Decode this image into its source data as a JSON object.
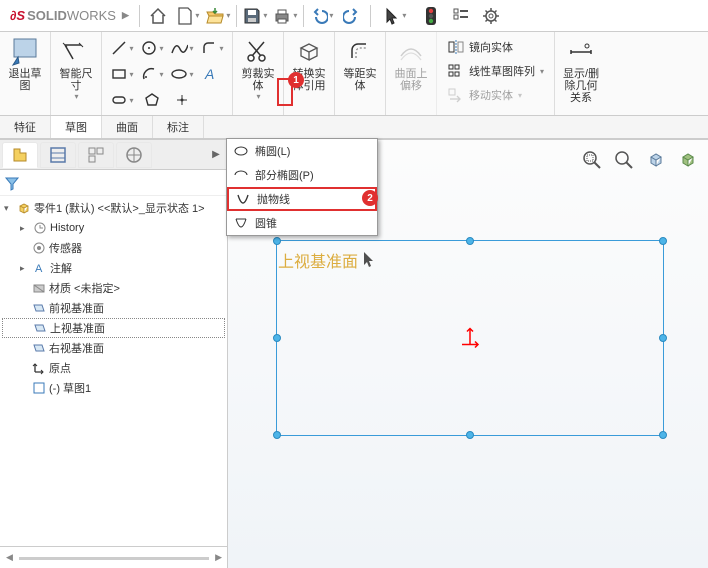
{
  "app": {
    "brand_prefix": "S",
    "brand": "SOLID",
    "brand2": "WORKS"
  },
  "ribbon": {
    "exit_sketch": "退出草\n图",
    "smart_dim": "智能尺\n寸",
    "trim": "剪裁实\n体",
    "convert": "转换实\n体引用",
    "offset": "等距实\n体",
    "on_surface": "曲面上\n偏移",
    "mirror": "镜向实体",
    "linear_pattern": "线性草图阵列",
    "move": "移动实体",
    "display": "显示/删\n除几何\n关系"
  },
  "tabs": {
    "t1": "特征",
    "t2": "草图",
    "t3": "曲面",
    "t4": "标注"
  },
  "menu": {
    "ellipse": "椭圆(L)",
    "partial_ellipse": "部分椭圆(P)",
    "parabola": "抛物线",
    "cone": "圆锥"
  },
  "tree": {
    "root": "零件1 (默认) <<默认>_显示状态 1>",
    "history": "History",
    "sensors": "传感器",
    "annotations": "注解",
    "material": "材质 <未指定>",
    "front": "前视基准面",
    "top": "上视基准面",
    "right": "右视基准面",
    "origin": "原点",
    "sketch1": "(-) 草图1"
  },
  "watermark": "上视基准面",
  "badges": {
    "b1": "1",
    "b2": "2"
  }
}
